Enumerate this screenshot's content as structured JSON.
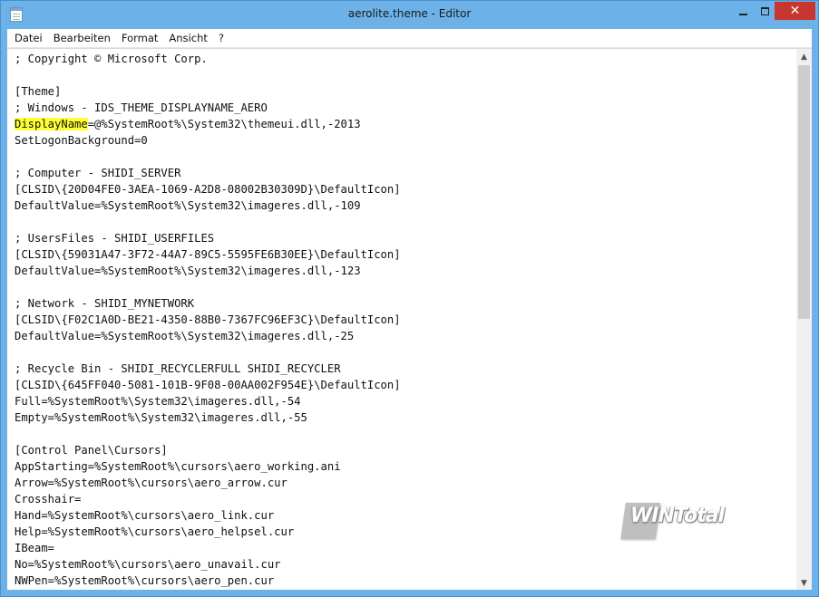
{
  "window": {
    "title": "aerolite.theme - Editor"
  },
  "menu": {
    "items": [
      "Datei",
      "Bearbeiten",
      "Format",
      "Ansicht",
      "?"
    ]
  },
  "editor": {
    "highlight": {
      "text": "DisplayName",
      "color": "#ffff33"
    },
    "lines": [
      "; Copyright © Microsoft Corp.",
      "",
      "[Theme]",
      "; Windows - IDS_THEME_DISPLAYNAME_AERO",
      "=@%SystemRoot%\\System32\\themeui.dll,-2013",
      "SetLogonBackground=0",
      "",
      "; Computer - SHIDI_SERVER",
      "[CLSID\\{20D04FE0-3AEA-1069-A2D8-08002B30309D}\\DefaultIcon]",
      "DefaultValue=%SystemRoot%\\System32\\imageres.dll,-109",
      "",
      "; UsersFiles - SHIDI_USERFILES",
      "[CLSID\\{59031A47-3F72-44A7-89C5-5595FE6B30EE}\\DefaultIcon]",
      "DefaultValue=%SystemRoot%\\System32\\imageres.dll,-123",
      "",
      "; Network - SHIDI_MYNETWORK",
      "[CLSID\\{F02C1A0D-BE21-4350-88B0-7367FC96EF3C}\\DefaultIcon]",
      "DefaultValue=%SystemRoot%\\System32\\imageres.dll,-25",
      "",
      "; Recycle Bin - SHIDI_RECYCLERFULL SHIDI_RECYCLER",
      "[CLSID\\{645FF040-5081-101B-9F08-00AA002F954E}\\DefaultIcon]",
      "Full=%SystemRoot%\\System32\\imageres.dll,-54",
      "Empty=%SystemRoot%\\System32\\imageres.dll,-55",
      "",
      "[Control Panel\\Cursors]",
      "AppStarting=%SystemRoot%\\cursors\\aero_working.ani",
      "Arrow=%SystemRoot%\\cursors\\aero_arrow.cur",
      "Crosshair=",
      "Hand=%SystemRoot%\\cursors\\aero_link.cur",
      "Help=%SystemRoot%\\cursors\\aero_helpsel.cur",
      "IBeam=",
      "No=%SystemRoot%\\cursors\\aero_unavail.cur",
      "NWPen=%SystemRoot%\\cursors\\aero_pen.cur"
    ]
  },
  "watermark": {
    "text": "WINTotal"
  },
  "colors": {
    "frame": "#6cb2e8",
    "close": "#c7372f",
    "highlight": "#ffff33"
  },
  "icons": {
    "app": "notepad-icon",
    "minimize": "minimize-icon",
    "maximize": "maximize-icon",
    "close": "close-icon"
  }
}
